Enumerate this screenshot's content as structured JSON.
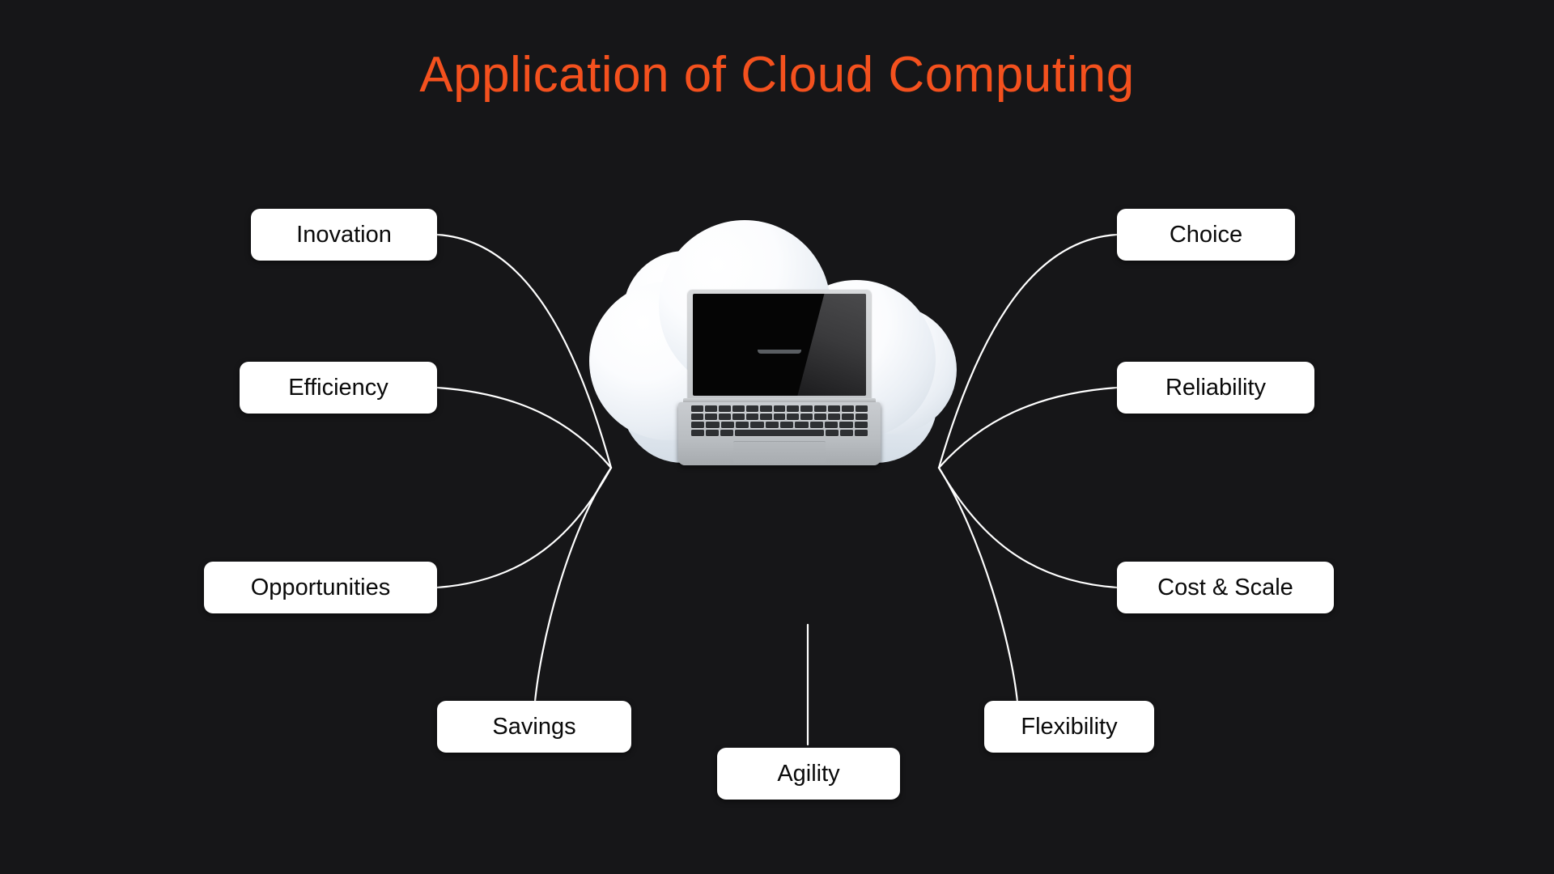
{
  "slide": {
    "title": "Application of Cloud Computing",
    "background_color": "#161618",
    "title_color": "#f4511e",
    "label_bg_color": "#ffffff",
    "label_text_color": "#0a0a0a",
    "connector_color": "#ffffff"
  },
  "center": {
    "cloud_icon": "cloud-icon",
    "laptop_icon": "laptop-icon"
  },
  "labels": {
    "innovation": "Inovation",
    "efficiency": "Efficiency",
    "opportunities": "Opportunities",
    "savings": "Savings",
    "agility": "Agility",
    "flexibility": "Flexibility",
    "cost_and_scale": "Cost & Scale",
    "reliability": "Reliability",
    "choice": "Choice"
  }
}
